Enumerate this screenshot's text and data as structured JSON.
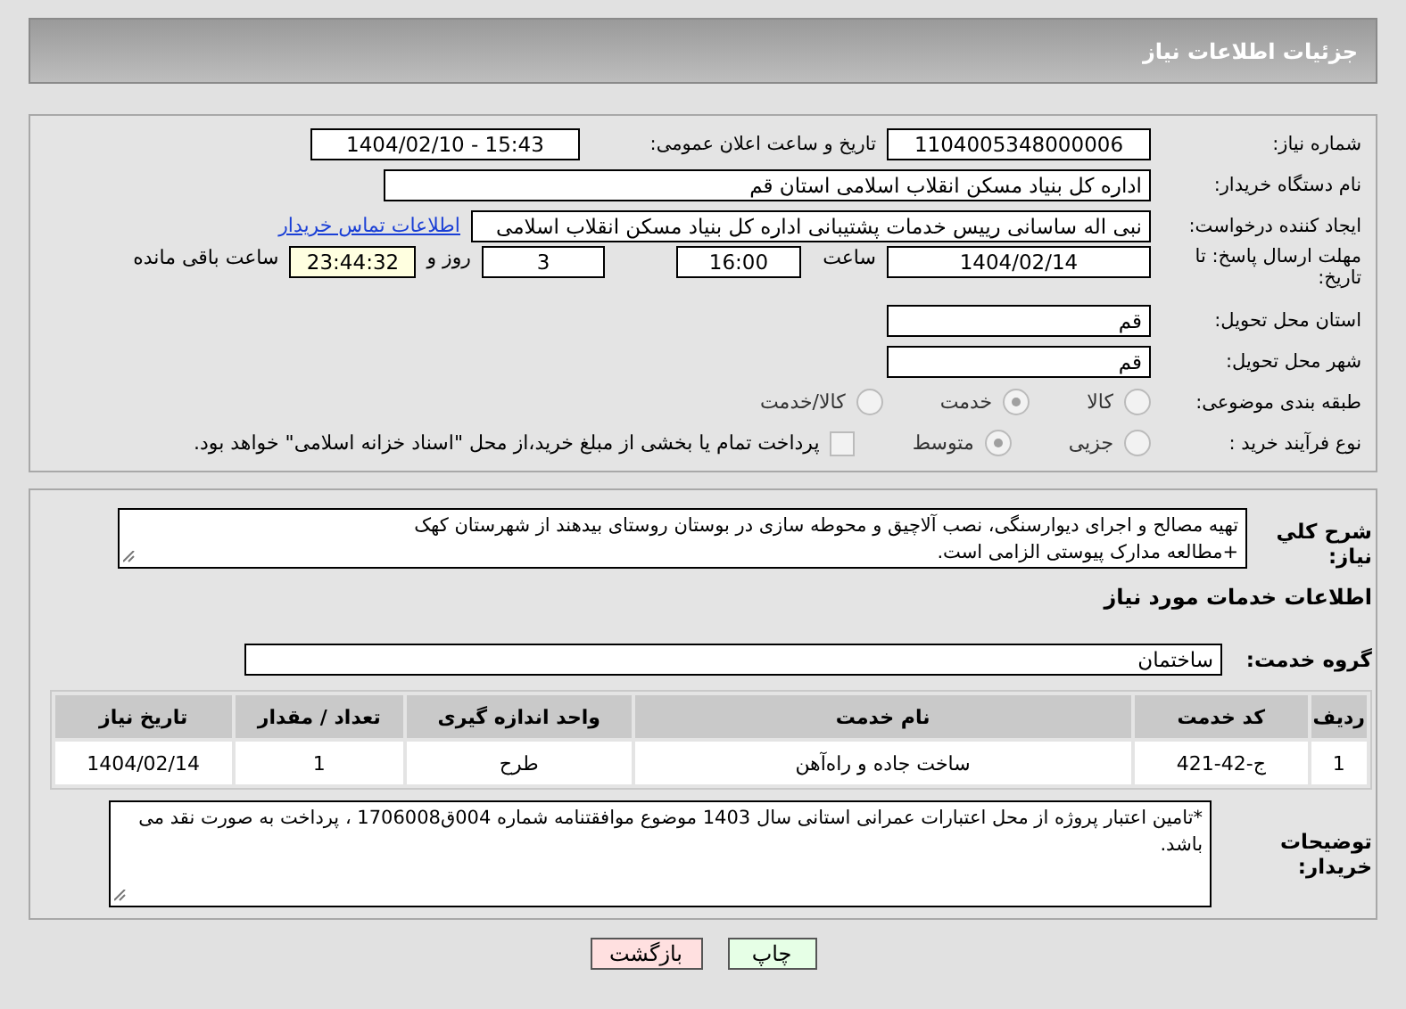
{
  "header": {
    "title": "جزئیات اطلاعات نیاز"
  },
  "details": {
    "need_number": {
      "label": "شماره نیاز:",
      "value": "1104005348000006"
    },
    "announce": {
      "label": "تاریخ و ساعت اعلان عمومی:",
      "value": "1404/02/10 - 15:43"
    },
    "buyer_org": {
      "label": "نام دستگاه خریدار:",
      "value": "اداره کل بنیاد مسکن انقلاب اسلامی استان قم"
    },
    "requester": {
      "label": "ایجاد کننده درخواست:",
      "value": "نبی اله ساسانی رییس خدمات پشتیبانی اداره کل بنیاد مسکن انقلاب اسلامی",
      "contact_link": "اطلاعات تماس خریدار"
    },
    "deadline": {
      "label": "مهلت ارسال پاسخ: تا تاریخ:",
      "date": "1404/02/14",
      "time_label": "ساعت",
      "time": "16:00",
      "days": "3",
      "days_label": "روز و",
      "remaining": "23:44:32",
      "remaining_label": "ساعت باقی مانده"
    },
    "province": {
      "label": "استان محل تحویل:",
      "value": "قم"
    },
    "city": {
      "label": "شهر محل تحویل:",
      "value": "قم"
    },
    "category": {
      "label": "طبقه بندی موضوعی:",
      "options": [
        {
          "label": "کالا",
          "selected": false
        },
        {
          "label": "خدمت",
          "selected": true
        },
        {
          "label": "کالا/خدمت",
          "selected": false
        }
      ]
    },
    "process": {
      "label": "نوع فرآیند خرید :",
      "options": [
        {
          "label": "جزیی",
          "selected": false
        },
        {
          "label": "متوسط",
          "selected": true
        }
      ],
      "treasury": {
        "label": "پرداخت تمام یا بخشی از مبلغ خرید،از محل \"اسناد خزانه اسلامی\" خواهد بود.",
        "checked": false
      }
    }
  },
  "needs": {
    "description": {
      "label": "شرح کلي نياز:",
      "value": "تهیه مصالح و اجرای دیوارسنگی، نصب آلاچیق و محوطه سازی در بوستان روستای بیدهند از شهرستان کهک\n+مطالعه مدارک پیوستی الزامی است."
    },
    "services_title": "اطلاعات خدمات مورد نیاز",
    "service_group": {
      "label": "گروه خدمت:",
      "value": "ساختمان"
    },
    "table": {
      "columns": [
        "ردیف",
        "کد خدمت",
        "نام خدمت",
        "واحد اندازه گیری",
        "تعداد / مقدار",
        "تاریخ نیاز"
      ],
      "rows": [
        [
          "1",
          "ج-42-421",
          "ساخت جاده و راه‌آهن",
          "طرح",
          "1",
          "1404/02/14"
        ]
      ]
    },
    "buyer_notes": {
      "label": "توضیحات خریدار:",
      "value": "*تامین اعتبار پروژه از محل اعتبارات عمرانی استانی سال 1403 موضوع موافقتنامه شماره 004ق1706008 ، پرداخت به صورت نقد می باشد."
    }
  },
  "buttons": [
    {
      "label": "چاپ",
      "kind": "print"
    },
    {
      "label": "بازگشت",
      "kind": "back"
    }
  ]
}
